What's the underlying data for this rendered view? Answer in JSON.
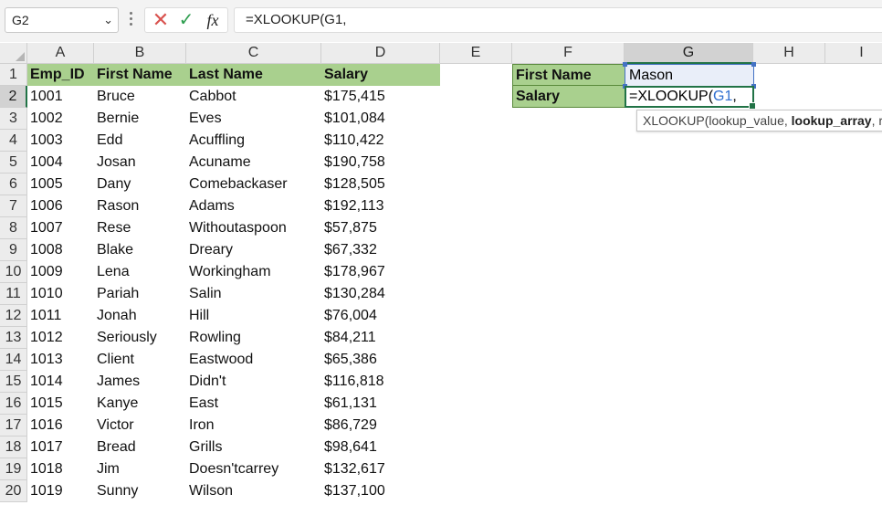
{
  "formula_bar": {
    "name_box": "G2",
    "formula": "=XLOOKUP(G1,"
  },
  "grid": {
    "columns": [
      "A",
      "B",
      "C",
      "D",
      "E",
      "F",
      "G",
      "H",
      "I"
    ],
    "selected_column": "G",
    "selected_row": "2",
    "rows": [
      "1",
      "2",
      "3",
      "4",
      "5",
      "6",
      "7",
      "8",
      "9",
      "10",
      "11",
      "12",
      "13",
      "14",
      "15",
      "16",
      "17",
      "18",
      "19",
      "20"
    ]
  },
  "table": {
    "headers": [
      "Emp_ID",
      "First Name",
      "Last Name",
      "Salary"
    ],
    "header_fill": "#a9d08e",
    "rows": [
      [
        "1001",
        "Bruce",
        "Cabbot",
        "$175,415"
      ],
      [
        "1002",
        "Bernie",
        "Eves",
        "$101,084"
      ],
      [
        "1003",
        "Edd",
        "Acuffling",
        "$110,422"
      ],
      [
        "1004",
        "Josan",
        "Acuname",
        "$190,758"
      ],
      [
        "1005",
        "Dany",
        "Comebackaser",
        "$128,505"
      ],
      [
        "1006",
        "Rason",
        "Adams",
        "$192,113"
      ],
      [
        "1007",
        "Rese",
        "Withoutaspoon",
        "$57,875"
      ],
      [
        "1008",
        "Blake",
        "Dreary",
        "$67,332"
      ],
      [
        "1009",
        "Lena",
        "Workingham",
        "$178,967"
      ],
      [
        "1010",
        "Pariah",
        "Salin",
        "$130,284"
      ],
      [
        "1011",
        "Jonah",
        "Hill",
        "$76,004"
      ],
      [
        "1012",
        "Seriously",
        "Rowling",
        "$84,211"
      ],
      [
        "1013",
        "Client",
        "Eastwood",
        "$65,386"
      ],
      [
        "1014",
        "James",
        "Didn't",
        "$116,818"
      ],
      [
        "1015",
        "Kanye",
        "East",
        "$61,131"
      ],
      [
        "1016",
        "Victor",
        "Iron",
        "$86,729"
      ],
      [
        "1017",
        "Bread",
        "Grills",
        "$98,641"
      ],
      [
        "1018",
        "Jim",
        "Doesn'tcarrey",
        "$132,617"
      ],
      [
        "1019",
        "Sunny",
        "Wilson",
        "$137,100"
      ]
    ]
  },
  "lookup": {
    "label_first_name": "First Name",
    "label_salary": "Salary",
    "first_name_value": "Mason",
    "formula_prefix": "=XLOOKUP(",
    "formula_ref": "G1",
    "formula_suffix": ","
  },
  "tooltip": {
    "prefix": "XLOOKUP(lookup_value, ",
    "bold_arg": "lookup_array",
    "suffix": ", return_array, [if_not_found], [match_mode], [search_mode])"
  }
}
